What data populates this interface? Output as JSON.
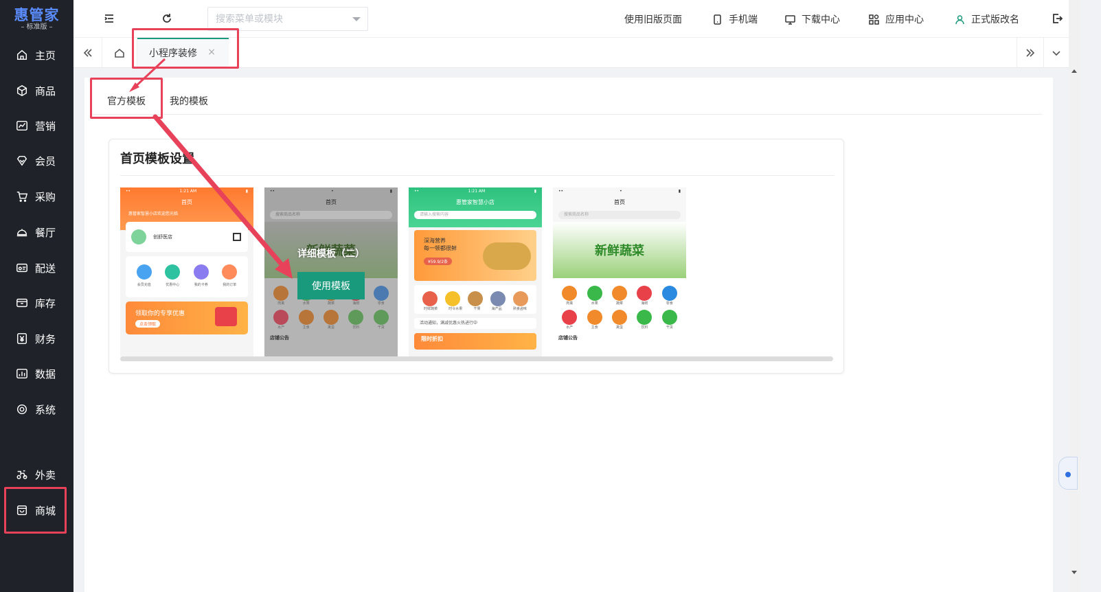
{
  "app": {
    "logo_title": "惠管家",
    "logo_subtitle": "标准版"
  },
  "sidebar": {
    "items": [
      {
        "label": "主页",
        "icon": "home-icon"
      },
      {
        "label": "商品",
        "icon": "box-icon"
      },
      {
        "label": "营销",
        "icon": "chart-line-icon"
      },
      {
        "label": "会员",
        "icon": "diamond-icon"
      },
      {
        "label": "采购",
        "icon": "cart-icon"
      },
      {
        "label": "餐厅",
        "icon": "cloche-icon"
      },
      {
        "label": "配送",
        "icon": "truck-icon"
      },
      {
        "label": "库存",
        "icon": "storage-icon"
      },
      {
        "label": "财务",
        "icon": "yuan-icon"
      },
      {
        "label": "数据",
        "icon": "bar-chart-icon"
      },
      {
        "label": "系统",
        "icon": "target-icon"
      },
      {
        "label": "外卖",
        "icon": "scooter-icon"
      },
      {
        "label": "商城",
        "icon": "shop-icon"
      }
    ]
  },
  "header": {
    "search_placeholder": "搜索菜单或模块",
    "old_page": "使用旧版页面",
    "mobile": "手机端",
    "download": "下载中心",
    "app_center": "应用中心",
    "rename": "正式版改名"
  },
  "tabs": {
    "active_tab": "小程序装修",
    "close_glyph": "×"
  },
  "subtabs": {
    "official": "官方模板",
    "mine": "我的模板"
  },
  "card": {
    "title": "首页模板设置",
    "hover_title": "详细模板（二）",
    "use_button": "使用模板"
  },
  "templates": [
    {
      "header": "首页",
      "status_time": "1:21 AM",
      "store_name": "创舒医店",
      "location_text": "惠管家智慧小店欢迎您光临",
      "icons": [
        "会员充值",
        "优惠中心",
        "我的卡券",
        "我的订单"
      ],
      "banner_text": "领取你的专享优惠",
      "banner_btn": "点击领取",
      "accent": "#ff7a30"
    },
    {
      "header": "首页",
      "search_text": "搜索商品名称",
      "banner_text": "新鲜蔬菜",
      "icons": [
        "肉禽",
        "水果",
        "蔬菜",
        "海鲜",
        "零食"
      ],
      "icons2": [
        "水产",
        "主食",
        "禽蛋",
        "饮料",
        "干货"
      ],
      "footer": "店铺公告",
      "accent": "#9c9c9c"
    },
    {
      "header": "惠管家智慧小店",
      "status_time": "1:21 AM",
      "search_text": "请输入搜索内容",
      "banner_line1": "深海营养",
      "banner_line2": "每一顿都很鲜",
      "banner_price": "¥59.9/2条",
      "icons": [
        "时鲜蔬菜",
        "时令水果",
        "干果",
        "海产品",
        "熟食卤味"
      ],
      "notice": "活动通知，满减优惠火热进行中",
      "bottom_text": "限时折扣",
      "accent": "#2ec27e"
    },
    {
      "header": "首页",
      "search_text": "搜索商品名称",
      "banner_text": "新鲜蔬菜",
      "icons": [
        "肉禽",
        "水果",
        "蔬菜",
        "海鲜",
        "零食"
      ],
      "icons2": [
        "水产",
        "主食",
        "禽蛋",
        "饮料",
        "干货"
      ],
      "footer": "店铺公告",
      "accent": "#ffffff"
    }
  ]
}
